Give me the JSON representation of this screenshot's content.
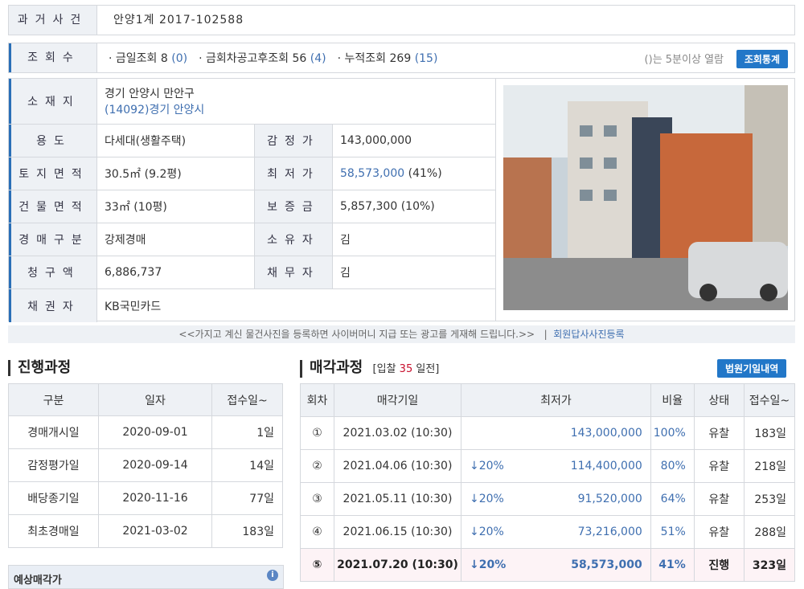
{
  "case": {
    "label": "과거사건",
    "value": "안양1계 2017-102588"
  },
  "views": {
    "label": "조회수",
    "items": [
      {
        "prefix": "· 금일조회",
        "count": "8",
        "paren": "(0)"
      },
      {
        "prefix": "· 금회차공고후조회",
        "count": "56",
        "paren": "(4)"
      },
      {
        "prefix": "· 누적조회",
        "count": "269",
        "paren": "(15)"
      }
    ],
    "note": "()는 5분이상 열람",
    "stats_button": "조회통계"
  },
  "info": {
    "location_label": "소재지",
    "location_line1": "경기 안양시 만안구",
    "location_line2": "(14092)경기 안양시",
    "use_label": "용도",
    "use_value": "다세대(생활주택)",
    "appraisal_label": "감정가",
    "appraisal_value": "143,000,000",
    "land_label": "토지면적",
    "land_value": "30.5㎡ (9.2평)",
    "min_label": "최저가",
    "min_value": "58,573,000",
    "min_pct": "(41%)",
    "building_label": "건물면적",
    "building_value": "33㎡ (10평)",
    "deposit_label": "보증금",
    "deposit_value": "5,857,300 (10%)",
    "type_label": "경매구분",
    "type_value": "강제경매",
    "owner_label": "소유자",
    "owner_value": "김",
    "claim_label": "청구액",
    "claim_value": "6,886,737",
    "debtor_label": "채무자",
    "debtor_value": "김",
    "creditor_label": "채권자",
    "creditor_value": "KB국민카드"
  },
  "ad_bar": {
    "text": "<<가지고 계신 물건사진을 등록하면 사이버머니 지급 또는 광고를 게재해 드립니다.>>",
    "sep": "|",
    "link": "회원답사사진등록"
  },
  "progress": {
    "title": "진행과정",
    "headers": [
      "구분",
      "일자",
      "접수일~"
    ],
    "rows": [
      {
        "name": "경매개시일",
        "date": "2020-09-01",
        "days": "1일"
      },
      {
        "name": "감정평가일",
        "date": "2020-09-14",
        "days": "14일"
      },
      {
        "name": "배당종기일",
        "date": "2020-11-16",
        "days": "77일"
      },
      {
        "name": "최초경매일",
        "date": "2021-03-02",
        "days": "183일"
      }
    ]
  },
  "auction": {
    "title": "매각과정",
    "sub_prefix": "[입찰",
    "sub_days": "35",
    "sub_suffix": "일전]",
    "court_button": "법원기일내역",
    "headers": [
      "회차",
      "매각기일",
      "최저가",
      "비율",
      "상태",
      "접수일~"
    ],
    "rows": [
      {
        "round": "①",
        "date": "2021.03.02 (10:30)",
        "down": "",
        "price": "143,000,000",
        "ratio": "100%",
        "status": "유찰",
        "days": "183일"
      },
      {
        "round": "②",
        "date": "2021.04.06 (10:30)",
        "down": "↓20%",
        "price": "114,400,000",
        "ratio": "80%",
        "status": "유찰",
        "days": "218일"
      },
      {
        "round": "③",
        "date": "2021.05.11 (10:30)",
        "down": "↓20%",
        "price": "91,520,000",
        "ratio": "64%",
        "status": "유찰",
        "days": "253일"
      },
      {
        "round": "④",
        "date": "2021.06.15 (10:30)",
        "down": "↓20%",
        "price": "73,216,000",
        "ratio": "51%",
        "status": "유찰",
        "days": "288일"
      },
      {
        "round": "⑤",
        "date": "2021.07.20 (10:30)",
        "down": "↓20%",
        "price": "58,573,000",
        "ratio": "41%",
        "status": "진행",
        "days": "323일"
      }
    ]
  },
  "expected": {
    "title": "예상매각가",
    "icon": "info-icon"
  },
  "colors": {
    "accent": "#2277c8",
    "label_bg": "#eef1f5",
    "link": "#3f6fb0",
    "current_row": "#fdf3f6",
    "days_red": "#c8102e"
  }
}
